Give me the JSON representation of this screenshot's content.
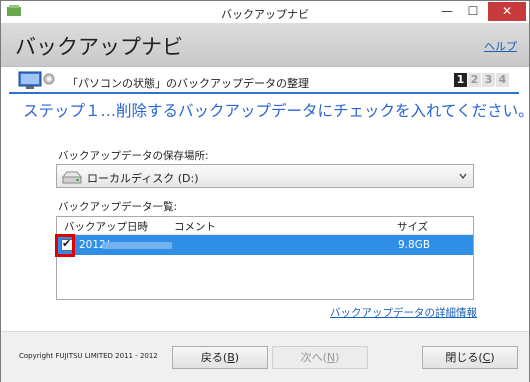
{
  "window": {
    "title": "バックアップナビ",
    "minimize": "—",
    "maximize": "☐",
    "close": "✕"
  },
  "header": {
    "title": "バックアップナビ",
    "help": "ヘルプ"
  },
  "step": {
    "context": "「パソコンの状態」のバックアップデータの整理",
    "numbers": [
      "1",
      "2",
      "3",
      "4"
    ],
    "active_step": 1,
    "heading": "ステップ１…削除するバックアップデータにチェックを入れてください。"
  },
  "location": {
    "label": "バックアップデータの保存場所:",
    "selected": "ローカルディスク (D:)"
  },
  "backup_list": {
    "label": "バックアップデータ一覧:",
    "columns": [
      "バックアップ日時",
      "コメント",
      "サイズ"
    ],
    "rows": [
      {
        "date": "2012/",
        "comment": "",
        "size": "9.8GB",
        "checked": true,
        "check_mark": "✔"
      }
    ]
  },
  "detail_link": "バックアップデータの詳細情報",
  "footer": {
    "copyright": "Copyright FUJITSU LIMITED 2011 - 2012",
    "back": {
      "label": "戻る(",
      "key": "B",
      "tail": ")"
    },
    "next": {
      "label": "次へ(",
      "key": "N",
      "tail": ")"
    },
    "close": {
      "label": "閉じる(",
      "key": "C",
      "tail": ")"
    }
  },
  "colors": {
    "accent": "#2a64d4",
    "selection": "#2f8fe6",
    "highlight_box": "#e00000",
    "close_button": "#c7393a"
  }
}
